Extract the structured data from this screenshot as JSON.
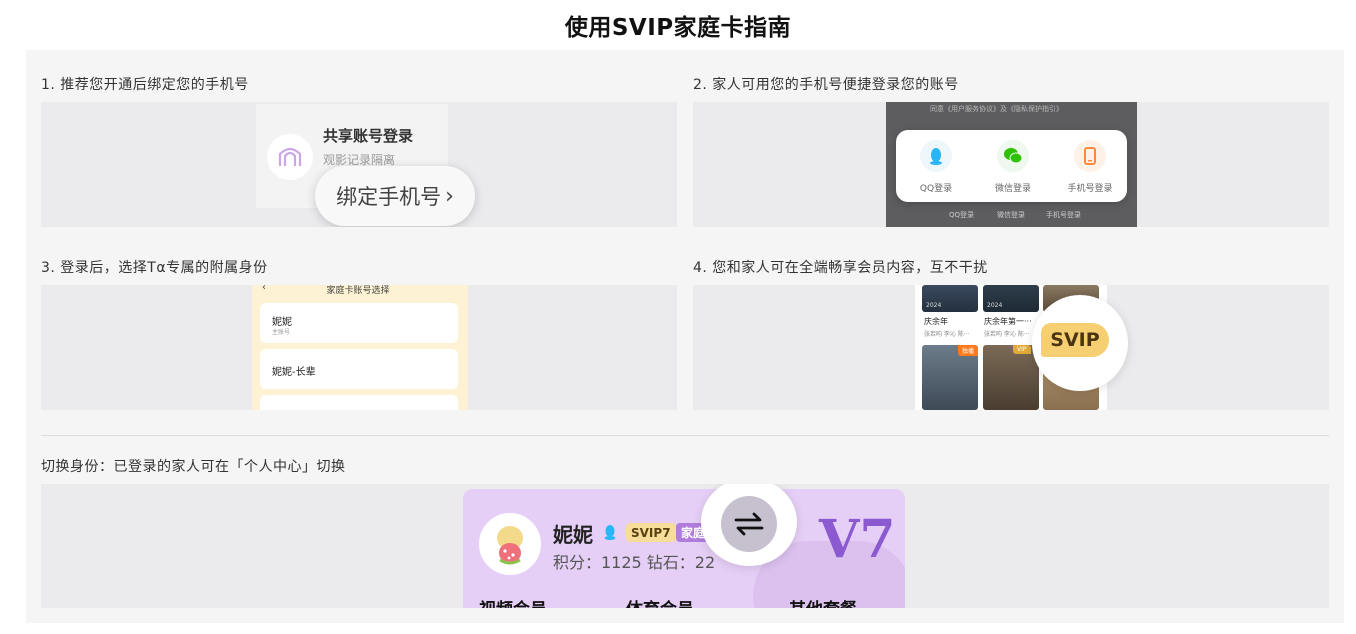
{
  "page_title": "使用SVIP家庭卡指南",
  "steps": [
    {
      "title": "1. 推荐您开通后绑定您的手机号"
    },
    {
      "title": "2. 家人可用您的手机号便捷登录您的账号"
    },
    {
      "title": "3. 登录后，选择Tα专属的附属身份"
    },
    {
      "title": "4. 您和家人可在全端畅享会员内容，互不干扰"
    }
  ],
  "step1": {
    "card_title": "共享账号登录",
    "card_sub": "观影记录隔离",
    "bind_button": "绑定手机号"
  },
  "step2": {
    "agreement": "同意《用户服务协议》及《隐私保护指引》",
    "options": [
      {
        "label": "QQ登录",
        "icon": "qq-icon",
        "color": "#29b6f6"
      },
      {
        "label": "微信登录",
        "icon": "wechat-icon",
        "color": "#2dc100"
      },
      {
        "label": "手机号登录",
        "icon": "phone-icon",
        "color": "#ff8a3d"
      }
    ],
    "bottom": [
      "QQ登录",
      "微信登录",
      "手机号登录"
    ]
  },
  "step3": {
    "header": "家庭卡账号选择",
    "items": [
      {
        "name": "妮妮",
        "sub": "主账号"
      },
      {
        "name": "妮妮-长辈",
        "sub": ""
      }
    ]
  },
  "step4": {
    "posters_top": [
      {
        "year": "2024"
      },
      {
        "year": "2024"
      }
    ],
    "titles": [
      {
        "name": "庆余年",
        "sub": "张若昀 李沁 陈···"
      },
      {
        "name": "庆余年第一···",
        "sub": "张若昀 李沁 陈···"
      }
    ],
    "tags": [
      "独播",
      "VIP"
    ],
    "svip_badge": "SVIP"
  },
  "switch_section": {
    "title": "切换身份：已登录的家人可在「个人中心」切换",
    "name": "妮妮",
    "svip_badge": "SVIP7",
    "family_badge": "家庭",
    "points": "积分：1125  钻石：22",
    "level": "V7",
    "categories": [
      "视频会员",
      "体育会员",
      "其他套餐"
    ]
  }
}
